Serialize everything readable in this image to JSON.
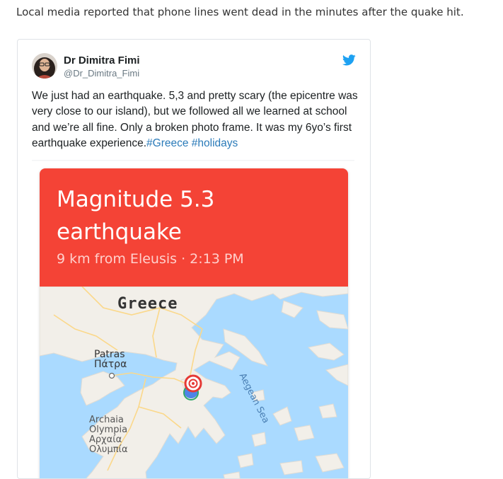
{
  "article": {
    "text": "Local media reported that phone lines went dead in the minutes after the quake hit."
  },
  "tweet": {
    "author_name": "Dr Dimitra Fimi",
    "author_handle": "@Dr_Dimitra_Fimi",
    "text_main": "We just had an earthquake. 5,3 and pretty scary (the epicentre was very close to our island), but we followed all we learned at school and we’re all fine. Only a broken photo frame. It was my 6yo’s first earthquake experience.",
    "hashtags": [
      "#Greece",
      "#holidays"
    ],
    "icons": {
      "avatar": "profile-photo",
      "brand": "twitter-bird-icon"
    },
    "colors": {
      "hashtag": "#2b7bb9",
      "bird": "#1da1f2"
    }
  },
  "earthquake_card": {
    "title_line1": "Magnitude 5.3",
    "title_line2": "earthquake",
    "subtitle": "9 km from Eleusis · 2:13 PM",
    "colors": {
      "header": "#f44336",
      "water": "#aadaff",
      "land": "#f2efe9"
    },
    "map": {
      "country_label": "Greece",
      "sea_label": "Aegean Sea",
      "city_patras_en": "Patras",
      "city_patras_gr": "Πάτρα",
      "city_olympia_en1": "Archaia",
      "city_olympia_en2": "Olympia",
      "city_olympia_gr1": "Αρχαία",
      "city_olympia_gr2": "Ολυμπία"
    }
  }
}
